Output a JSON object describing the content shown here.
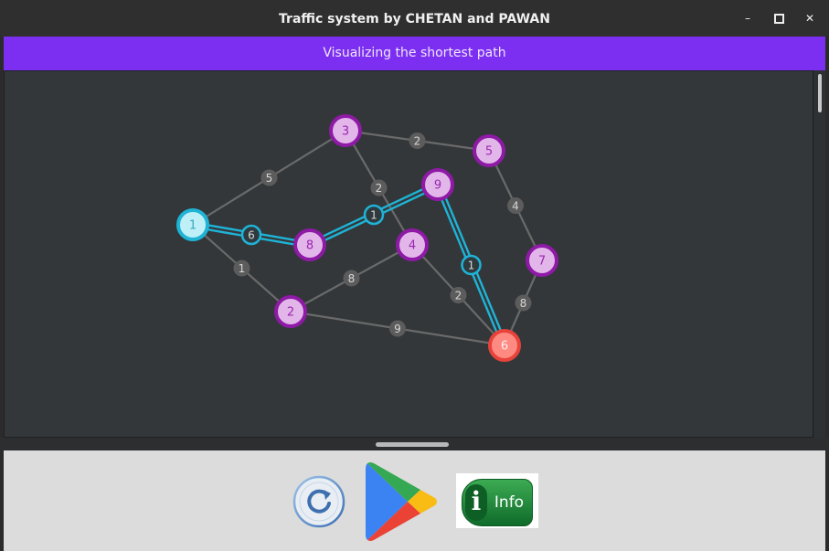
{
  "window": {
    "title": "Traffic system by CHETAN and PAWAN",
    "minimize_glyph": "–",
    "maximize_glyph": "▫",
    "close_glyph": "✕"
  },
  "banner": {
    "text": "Visualizing the shortest path"
  },
  "graph": {
    "nodes": [
      {
        "id": "1",
        "state": "source"
      },
      {
        "id": "2",
        "state": "normal"
      },
      {
        "id": "3",
        "state": "normal"
      },
      {
        "id": "4",
        "state": "normal"
      },
      {
        "id": "5",
        "state": "normal"
      },
      {
        "id": "6",
        "state": "destination"
      },
      {
        "id": "7",
        "state": "normal"
      },
      {
        "id": "8",
        "state": "path"
      },
      {
        "id": "9",
        "state": "path"
      }
    ],
    "edges": [
      {
        "from": "1",
        "to": "3",
        "weight": "5",
        "on_path": false
      },
      {
        "from": "1",
        "to": "8",
        "weight": "6",
        "on_path": true
      },
      {
        "from": "1",
        "to": "2",
        "weight": "1",
        "on_path": false
      },
      {
        "from": "3",
        "to": "5",
        "weight": "2",
        "on_path": false
      },
      {
        "from": "3",
        "to": "4",
        "weight": "2",
        "on_path": false
      },
      {
        "from": "8",
        "to": "9",
        "weight": "1",
        "on_path": true
      },
      {
        "from": "2",
        "to": "4",
        "weight": "8",
        "on_path": false
      },
      {
        "from": "2",
        "to": "6",
        "weight": "9",
        "on_path": false
      },
      {
        "from": "4",
        "to": "6",
        "weight": "2",
        "on_path": false
      },
      {
        "from": "9",
        "to": "6",
        "weight": "1",
        "on_path": true
      },
      {
        "from": "5",
        "to": "7",
        "weight": "4",
        "on_path": false
      },
      {
        "from": "7",
        "to": "6",
        "weight": "8",
        "on_path": false
      }
    ]
  },
  "colors": {
    "canvas_bg": "#33373a",
    "edge": "#6a6a6a",
    "weight_badge": "#5c5c5c",
    "path": "#1fb3d6",
    "node_fill": "#e3b6ea",
    "node_border": "#8e1aa6",
    "node_text": "#9a27b0",
    "source_fill": "#bff0f7",
    "destination_fill": "#ff8a82",
    "destination_border": "#e7433b",
    "banner": "#7c2ff0"
  },
  "toolbar": {
    "reset_icon": "refresh-icon",
    "play_icon": "play-store-icon",
    "info_label": "Info",
    "info_letter": "i"
  }
}
